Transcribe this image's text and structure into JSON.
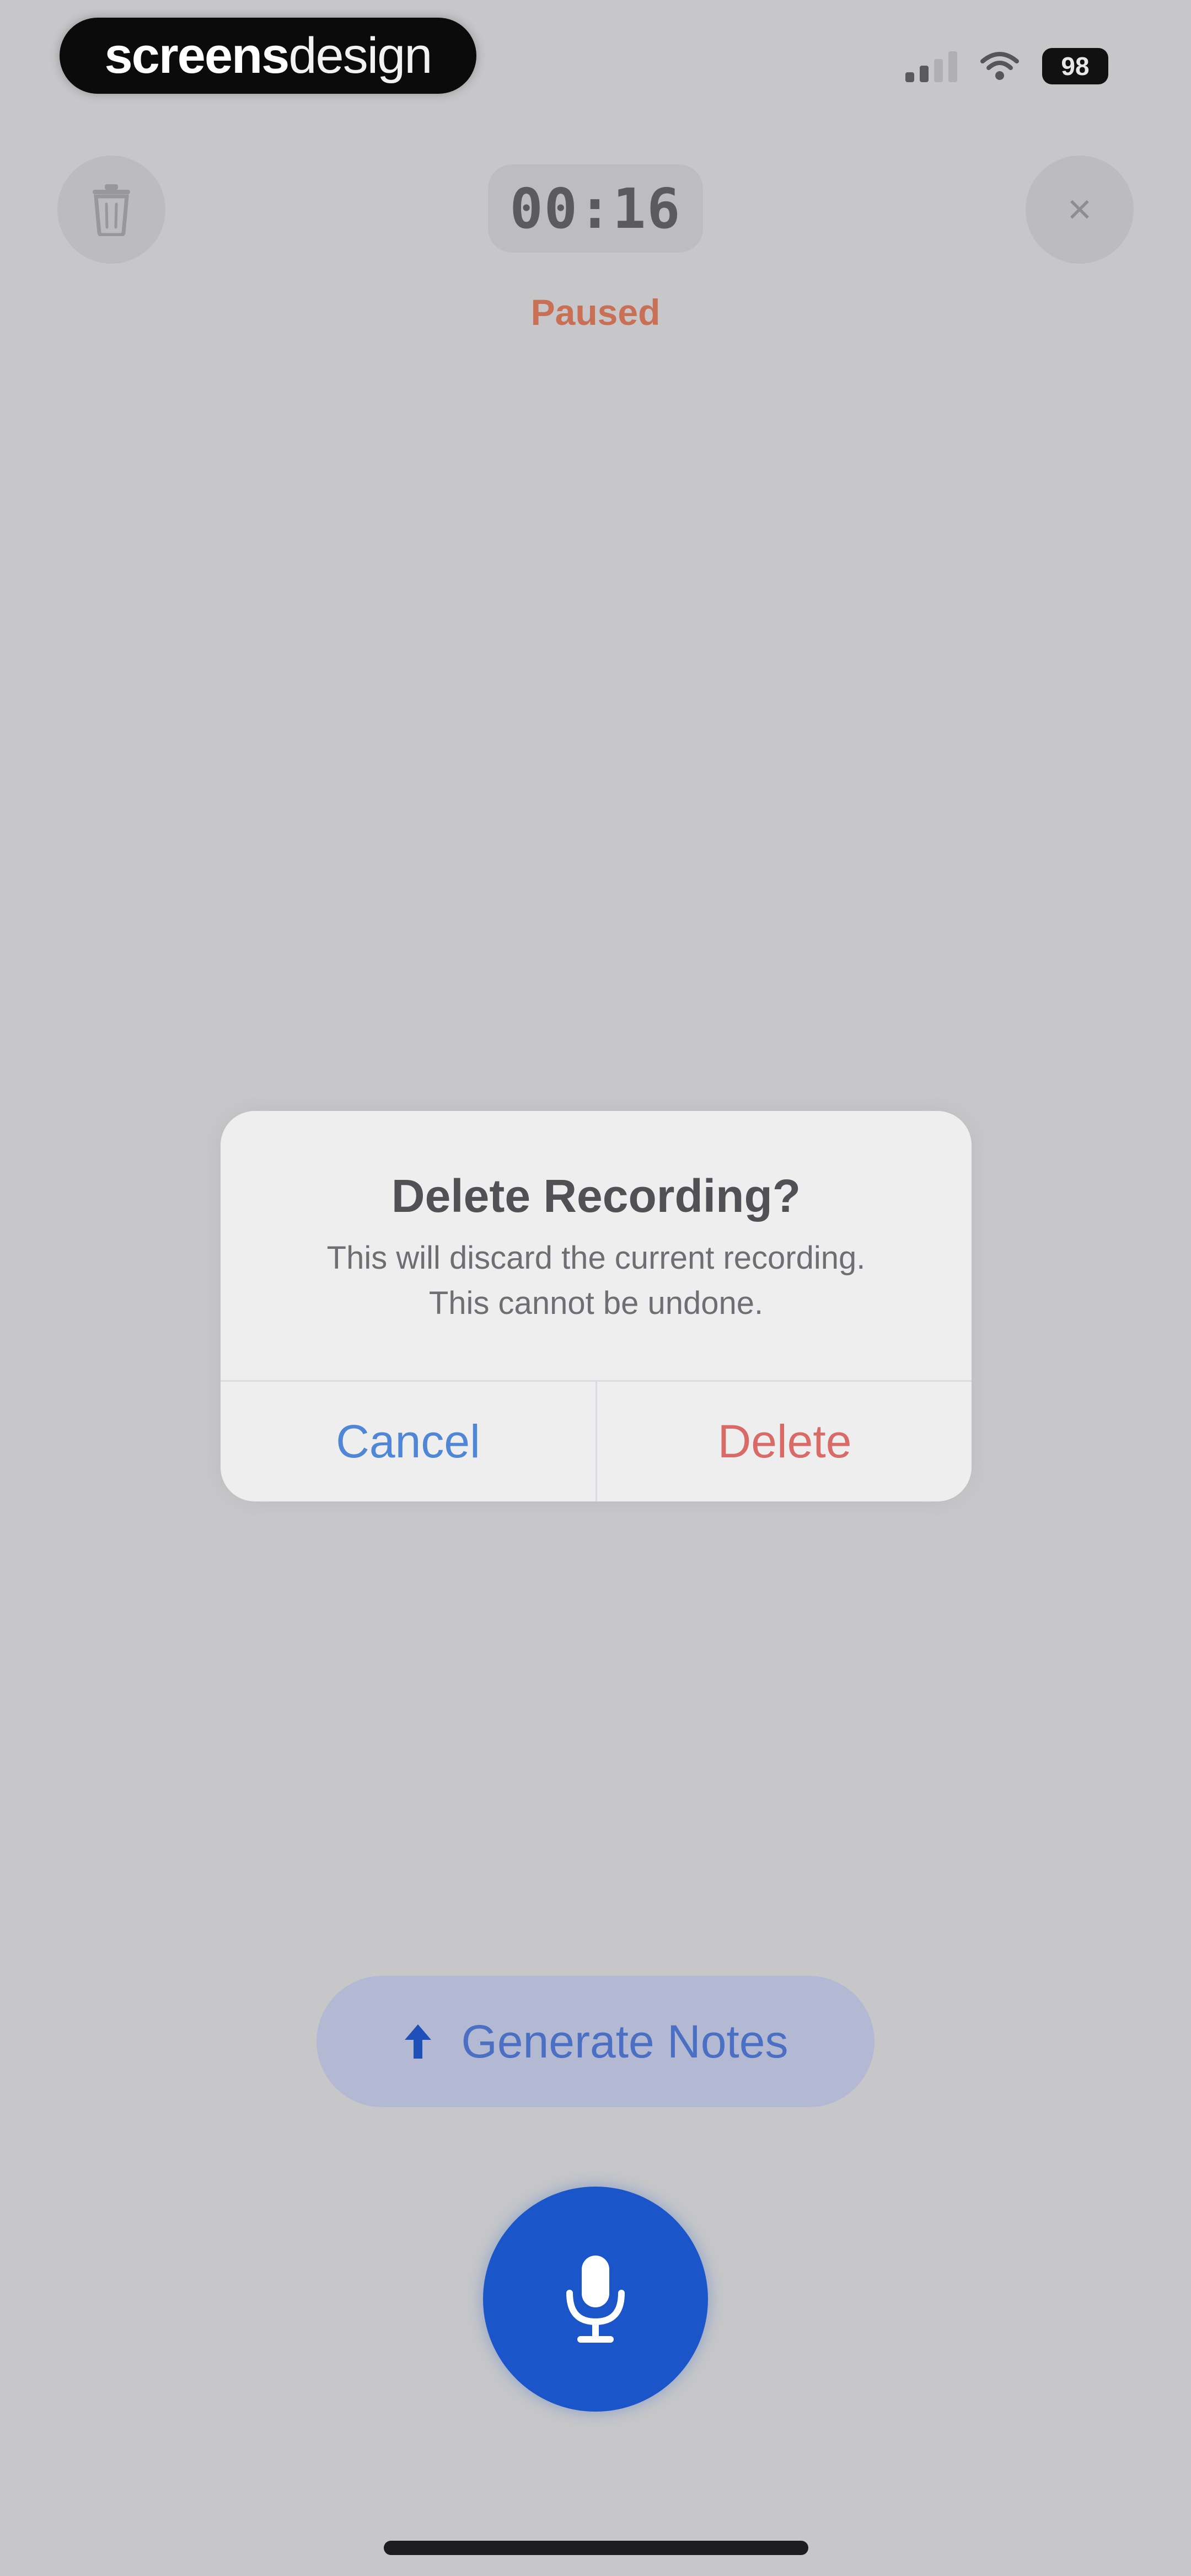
{
  "status_bar": {
    "brand_bold": "screens",
    "brand_light": "design",
    "battery": "98"
  },
  "recorder": {
    "timer": "00:16",
    "state": "Paused"
  },
  "dialog": {
    "title": "Delete Recording?",
    "message_line1": "This will discard the current recording.",
    "message_line2": "This cannot be undone.",
    "cancel_label": "Cancel",
    "delete_label": "Delete"
  },
  "actions": {
    "generate_label": "Generate Notes"
  },
  "colors": {
    "background": "#c7c7c9",
    "accent_blue": "#1a55c9",
    "cancel_blue": "#4f86d6",
    "delete_red": "#d86a68",
    "paused_red": "#c96f55"
  }
}
